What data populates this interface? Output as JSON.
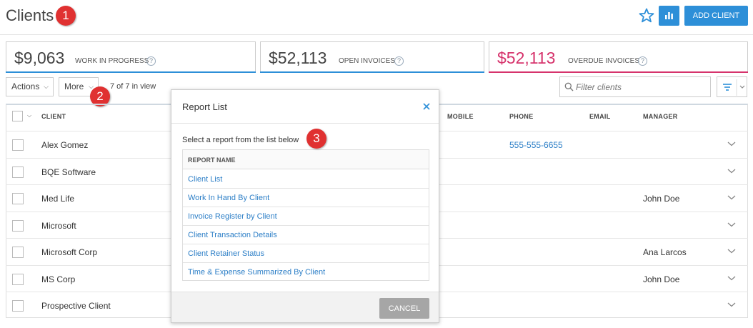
{
  "header": {
    "title": "Clients",
    "add_client_label": "ADD CLIENT",
    "accent_color": "#2d8fd8"
  },
  "callouts": [
    "1",
    "2",
    "3"
  ],
  "summary": [
    {
      "amount": "$9,063",
      "label": "WORK IN PROGRESS",
      "help": "?",
      "color": "#444444",
      "underline": "#2d8fd8"
    },
    {
      "amount": "$52,113",
      "label": "OPEN INVOICES",
      "help": "?",
      "color": "#444444",
      "underline": "#2d8fd8"
    },
    {
      "amount": "$52,113",
      "label": "OVERDUE INVOICES",
      "help": "?",
      "color": "#d6336c",
      "underline": "#d6336c"
    }
  ],
  "toolbar": {
    "actions_label": "Actions",
    "more_label": "More",
    "in_view": "7 of 7 in view",
    "filter_placeholder": "Filter clients"
  },
  "table": {
    "columns": {
      "client": "CLIENT",
      "mobile": "MOBILE",
      "phone": "PHONE",
      "email": "EMAIL",
      "manager": "MANAGER"
    },
    "rows": [
      {
        "client": "Alex Gomez",
        "phone": "555-555-6655",
        "manager": ""
      },
      {
        "client": "BQE Software",
        "phone": "",
        "manager": ""
      },
      {
        "client": "Med Life",
        "phone": "",
        "manager": "John Doe"
      },
      {
        "client": "Microsoft",
        "phone": "",
        "manager": ""
      },
      {
        "client": "Microsoft Corp",
        "phone": "",
        "manager": "Ana Larcos"
      },
      {
        "client": "MS Corp",
        "phone": "",
        "manager": "John Doe"
      },
      {
        "client": "Prospective Client",
        "phone": "",
        "manager": ""
      }
    ]
  },
  "modal": {
    "title": "Report List",
    "intro": "Select a report from the list below",
    "column_header": "REPORT NAME",
    "reports": [
      "Client List",
      "Work In Hand By Client",
      "Invoice Register by Client",
      "Client Transaction Details",
      "Client Retainer Status",
      "Time & Expense Summarized By Client"
    ],
    "cancel_label": "CANCEL"
  }
}
